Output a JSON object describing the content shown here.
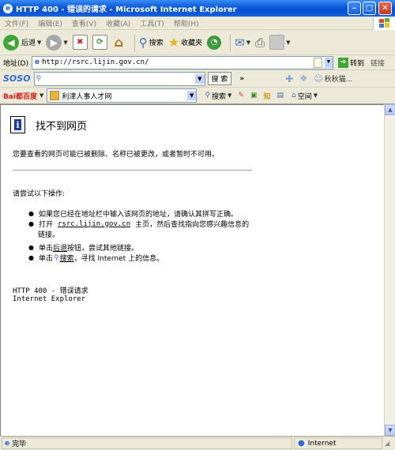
{
  "window": {
    "title": "HTTP 400 - 错误的请求 - Microsoft Internet Explorer"
  },
  "menu": [
    "文件(F)",
    "编辑(E)",
    "查看(V)",
    "收藏(A)",
    "工具(T)",
    "帮助(H)"
  ],
  "toolbar": {
    "back": "后退",
    "search": "搜索",
    "favorites": "收藏夹"
  },
  "address": {
    "label": "地址(D)",
    "url": "http://rsrc.lijin.gov.cn/",
    "go": "转到",
    "links": "链接"
  },
  "soso": {
    "logo": "SOSO",
    "search_button": "搜 索",
    "more": "»",
    "extra_text": "秋秋猫..."
  },
  "baidu": {
    "logo": "Bai都百度",
    "query": "利津人事人才网",
    "search_button": "搜索",
    "space": "空间"
  },
  "content": {
    "title": "找不到网页",
    "description": "您要查看的网页可能已被删除、名称已被更改，或者暂时不可用。",
    "try_heading": "请尝试以下操作:",
    "bullet1": "如果您已经在地址栏中输入该网页的地址，请确认其拼写正确。",
    "bullet2_pre": "打开",
    "bullet2_link": "rsrc.lijin.gov.cn",
    "bullet2_post": "主页，然后查找指向您感兴趣信息的",
    "bullet2_line2": "链接。",
    "bullet3_pre": "单击",
    "bullet3_link": "后退",
    "bullet3_post": "按钮，尝试其他链接。",
    "bullet4_pre": "单击",
    "bullet4_link": "搜索",
    "bullet4_post": "，寻找 Internet 上的信息。",
    "error_code": "HTTP 400 - 错误请求",
    "product": "Internet Explorer"
  },
  "status": {
    "left": "完毕",
    "zone": "Internet"
  }
}
